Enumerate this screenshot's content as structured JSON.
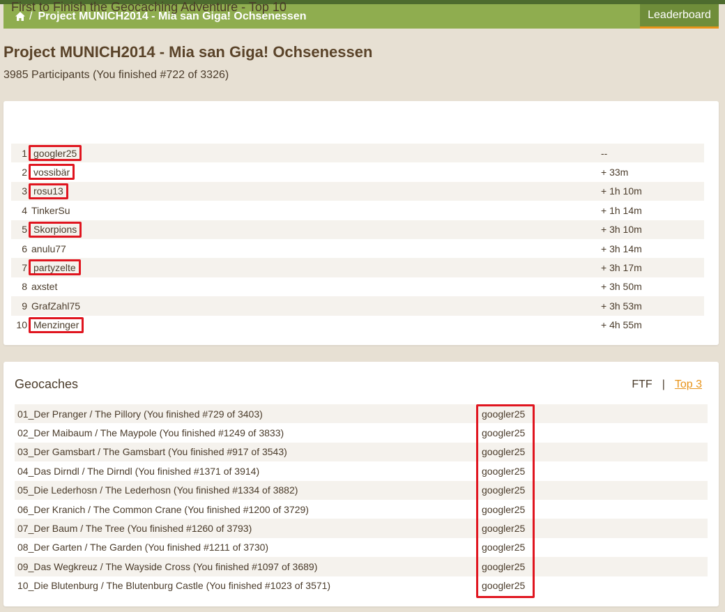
{
  "breadcrumb": {
    "home_icon": "home-icon",
    "separator": "/",
    "title": "Project MUNICH2014 - Mia san Giga! Ochsenessen"
  },
  "nav": {
    "leaderboard_label": "Leaderboard"
  },
  "page": {
    "title": "Project MUNICH2014 - Mia san Giga! Ochsenessen",
    "participants": "3985 Participants (You finished #722 of 3326)"
  },
  "ftf": {
    "title": "First to Finish the Geocaching Adventure - Top 10",
    "rows": [
      {
        "rank": "1",
        "name": "googler25",
        "time": "--",
        "highlighted": true
      },
      {
        "rank": "2",
        "name": "vossibär",
        "time": "+ 33m",
        "highlighted": true
      },
      {
        "rank": "3",
        "name": "rosu13",
        "time": "+ 1h 10m",
        "highlighted": true
      },
      {
        "rank": "4",
        "name": "TinkerSu",
        "time": "+ 1h 14m",
        "highlighted": false
      },
      {
        "rank": "5",
        "name": "Skorpions",
        "time": "+ 3h 10m",
        "highlighted": true
      },
      {
        "rank": "6",
        "name": "anulu77",
        "time": "+ 3h 14m",
        "highlighted": false
      },
      {
        "rank": "7",
        "name": "partyzelte",
        "time": "+ 3h 17m",
        "highlighted": true
      },
      {
        "rank": "8",
        "name": "axstet",
        "time": "+ 3h 50m",
        "highlighted": false
      },
      {
        "rank": "9",
        "name": "GrafZahl75",
        "time": "+ 3h 53m",
        "highlighted": false
      },
      {
        "rank": "10",
        "name": "Menzinger",
        "time": "+ 4h 55m",
        "highlighted": true
      }
    ]
  },
  "geocaches": {
    "title": "Geocaches",
    "filter_ftf": "FTF",
    "filter_sep": "|",
    "filter_top3": "Top 3",
    "rows": [
      {
        "name": "01_Der Pranger / The Pillory (You finished #729 of 3403)",
        "user": "googler25"
      },
      {
        "name": "02_Der Maibaum / The Maypole (You finished #1249 of 3833)",
        "user": "googler25"
      },
      {
        "name": "03_Der Gamsbart / The Gamsbart (You finished #917 of 3543)",
        "user": "googler25"
      },
      {
        "name": "04_Das Dirndl / The Dirndl (You finished #1371 of 3914)",
        "user": "googler25"
      },
      {
        "name": "05_Die Lederhosn / The Lederhosn (You finished #1334 of 3882)",
        "user": "googler25"
      },
      {
        "name": "06_Der Kranich / The Common Crane (You finished #1200 of 3729)",
        "user": "googler25"
      },
      {
        "name": "07_Der Baum / The Tree (You finished #1260 of 3793)",
        "user": "googler25"
      },
      {
        "name": "08_Der Garten / The Garden (You finished #1211 of 3730)",
        "user": "googler25"
      },
      {
        "name": "09_Das Wegkreuz / The Wayside Cross (You finished #1097 of 3689)",
        "user": "googler25"
      },
      {
        "name": "10_Die Blutenburg / The Blutenburg Castle (You finished #1023 of 3571)",
        "user": "googler25"
      }
    ]
  },
  "colors": {
    "nav_green": "#8fad4f",
    "nav_tab_green": "#6f8d3a",
    "accent_orange": "#e8941a",
    "highlight_red": "#e0151f"
  }
}
